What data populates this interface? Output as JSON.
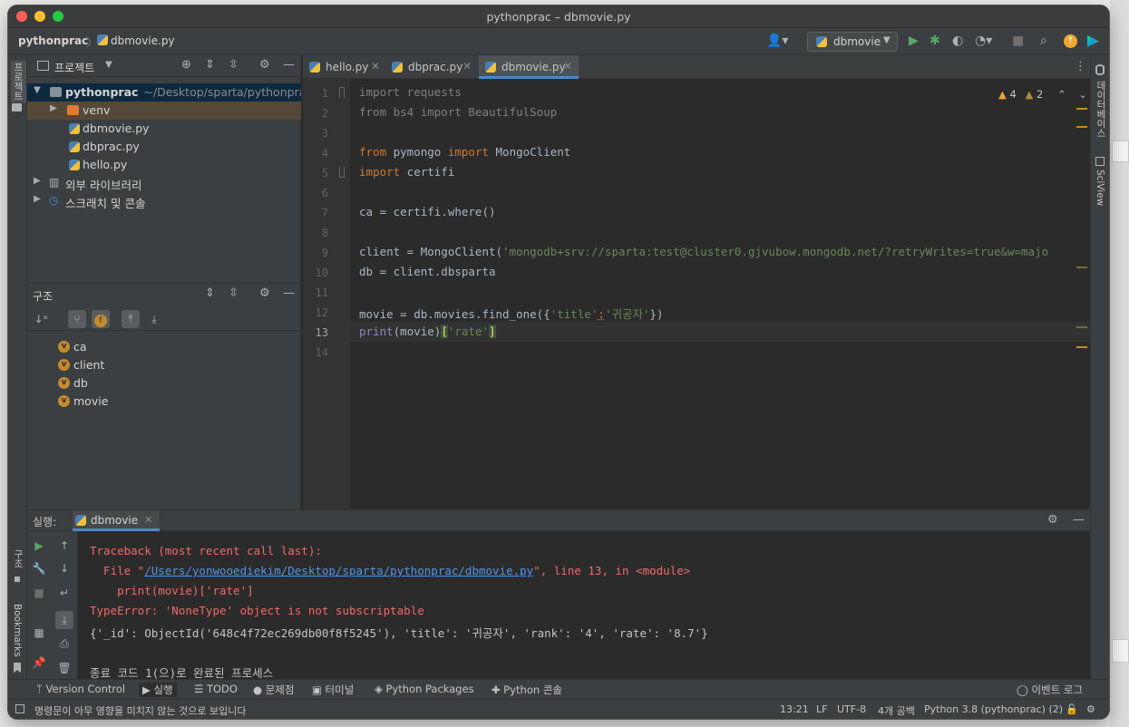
{
  "window": {
    "title": "pythonprac – dbmovie.py"
  },
  "breadcrumb": {
    "project": "pythonprac",
    "file": "dbmovie.py"
  },
  "run_config": {
    "label": "dbmovie"
  },
  "left_strip": {
    "project_label": "프로젝트",
    "structure_label": "구조",
    "bookmarks_label": "Bookmarks"
  },
  "right_strip": {
    "database_label": "데이터베이스",
    "sciview_label": "SciView"
  },
  "project_panel": {
    "title": "프로젝트",
    "root": {
      "name": "pythonprac",
      "path": "~/Desktop/sparta/pythonprac"
    },
    "items": [
      {
        "name": "venv"
      },
      {
        "name": "dbmovie.py"
      },
      {
        "name": "dbprac.py"
      },
      {
        "name": "hello.py"
      },
      {
        "name": "외부 라이브러리"
      },
      {
        "name": "스크래치 및 콘솔"
      }
    ]
  },
  "structure_panel": {
    "title": "구조",
    "items": [
      {
        "badge": "v",
        "name": "ca"
      },
      {
        "badge": "v",
        "name": "client"
      },
      {
        "badge": "v",
        "name": "db"
      },
      {
        "badge": "v",
        "name": "movie"
      }
    ]
  },
  "editor_tabs": [
    {
      "label": "hello.py"
    },
    {
      "label": "dbprac.py"
    },
    {
      "label": "dbmovie.py",
      "active": true
    }
  ],
  "inspections": {
    "warnings": "4",
    "weak_warnings": "2"
  },
  "code": {
    "line_numbers": [
      "1",
      "2",
      "3",
      "4",
      "5",
      "6",
      "7",
      "8",
      "9",
      "10",
      "11",
      "12",
      "13",
      "14"
    ],
    "l1": {
      "a": "import requests"
    },
    "l2": {
      "a": "from bs4 import BeautifulSoup"
    },
    "l4": {
      "kw1": "from",
      "mod": " pymongo ",
      "kw2": "import",
      "rest": " MongoClient"
    },
    "l5": {
      "kw": "import",
      "rest": " certifi"
    },
    "l7": {
      "a": "ca = certifi.where()"
    },
    "l9": {
      "a": "client = MongoClient(",
      "s": "'mongodb+srv://sparta:test@cluster0.gjvubow.mongodb.net/?retryWrites=true&w=majo"
    },
    "l10": {
      "a": "db = client.dbsparta"
    },
    "l12": {
      "a": "movie = db.movies.find_one({",
      "s1": "'title'",
      "c": ":",
      "s2": "'귀공자'",
      "e": "})"
    },
    "l13": {
      "fn": "print",
      "a": "(movie)",
      "b1": "[",
      "s": "'rate'",
      "b2": "]"
    }
  },
  "run_panel": {
    "title": "실행:",
    "tab": "dbmovie",
    "output": {
      "line1": "Traceback (most recent call last):",
      "line2_a": "  File \"",
      "line2_link": "/Users/yonwooediekim/Desktop/sparta/pythonprac/dbmovie.py",
      "line2_b": "\", line 13, in <module>",
      "line3": "    print(movie)['rate']",
      "line4": "TypeError: 'NoneType' object is not subscriptable",
      "line5": "{'_id': ObjectId('648c4f72ec269db00f8f5245'), 'title': '귀공자', 'rank': '4', 'rate': '8.7'}",
      "line7": "종료 코드 1(으)로 완료된 프로세스"
    }
  },
  "tool_windows": [
    {
      "label": "Version Control"
    },
    {
      "label": "실행"
    },
    {
      "label": "TODO"
    },
    {
      "label": "문제점"
    },
    {
      "label": "터미널"
    },
    {
      "label": "Python Packages"
    },
    {
      "label": "Python 콘솔"
    }
  ],
  "event_log": "이벤트 로그",
  "status_bar": {
    "message": "명령문이 아무 영향을 미치지 않는 것으로 보입니다",
    "position": "13:21",
    "line_sep": "LF",
    "encoding": "UTF-8",
    "indent": "4개 공백",
    "interpreter": "Python 3.8 (pythonprac) (2)"
  }
}
